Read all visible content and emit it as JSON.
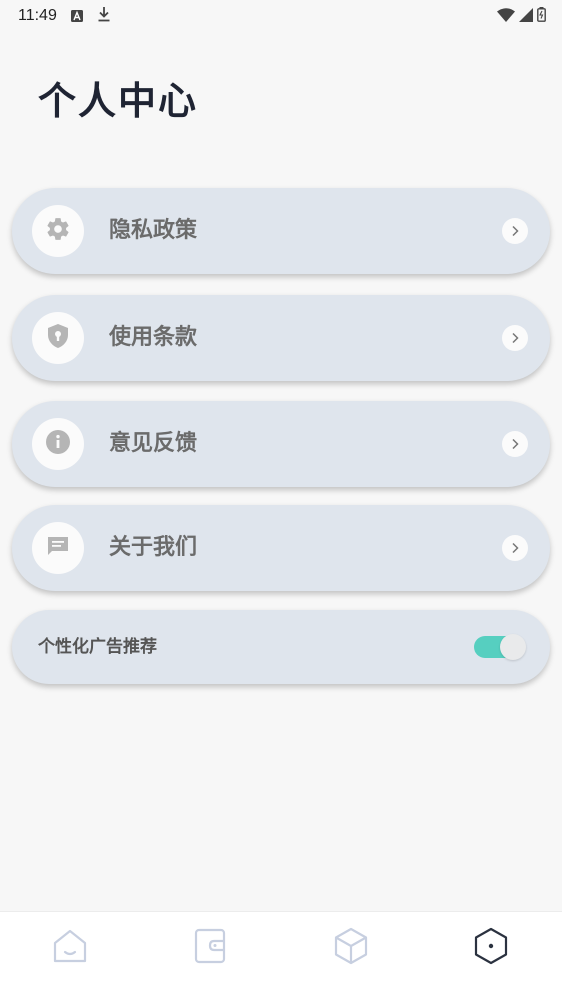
{
  "status_bar": {
    "time": "11:49",
    "icons": [
      "a-notification-icon",
      "download-icon",
      "wifi-icon",
      "signal-icon",
      "battery-icon"
    ]
  },
  "page": {
    "title": "个人中心"
  },
  "menu": {
    "items": [
      {
        "label": "隐私政策",
        "icon": "gear-icon"
      },
      {
        "label": "使用条款",
        "icon": "shield-icon"
      },
      {
        "label": "意见反馈",
        "icon": "info-icon"
      },
      {
        "label": "关于我们",
        "icon": "chat-icon"
      }
    ]
  },
  "ad_toggle": {
    "label": "个性化广告推荐",
    "enabled": true,
    "accent_color": "#56cfc0"
  },
  "bottom_nav": {
    "items": [
      {
        "name": "home",
        "icon": "home-icon",
        "active": false
      },
      {
        "name": "wallet",
        "icon": "wallet-icon",
        "active": false
      },
      {
        "name": "box",
        "icon": "cube-icon",
        "active": false
      },
      {
        "name": "profile",
        "icon": "hexagon-icon",
        "active": true
      }
    ]
  }
}
